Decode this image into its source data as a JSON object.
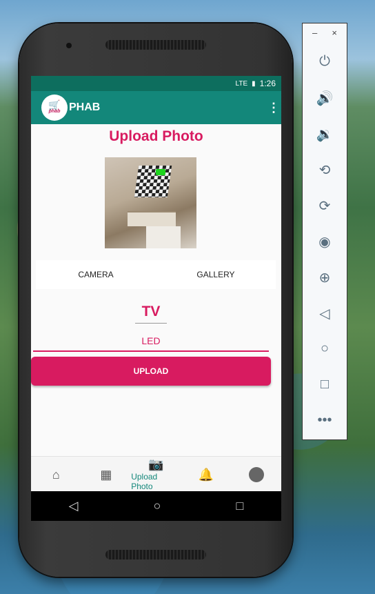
{
  "status_bar": {
    "network": "LTE",
    "time": "1:26"
  },
  "app_bar": {
    "logo_text": "phab",
    "title": "PHAB",
    "menu_icon": "more-vert-icon"
  },
  "page": {
    "heading": "Upload Photo",
    "photo_buttons": [
      "CAMERA",
      "GALLERY"
    ],
    "category": "TV",
    "item_name": "LED",
    "upload_label": "UPLOAD"
  },
  "bottom_nav": {
    "items": [
      {
        "icon": "home-icon",
        "label": ""
      },
      {
        "icon": "dashboard-icon",
        "label": ""
      },
      {
        "icon": "camera-icon",
        "label": "Upload Photo",
        "active": true
      },
      {
        "icon": "bell-icon",
        "label": ""
      },
      {
        "icon": "avatar-icon",
        "label": ""
      }
    ]
  },
  "emulator_panel": {
    "window_controls": [
      "–",
      "×"
    ],
    "tools": [
      "power-icon",
      "volume-up-icon",
      "volume-down-icon",
      "rotate-left-icon",
      "rotate-right-icon",
      "screenshot-icon",
      "zoom-icon",
      "back-icon",
      "home-icon",
      "overview-icon",
      "more-icon"
    ]
  },
  "colors": {
    "primary": "#13877a",
    "status": "#0d6e5e",
    "accent": "#d81b60"
  }
}
